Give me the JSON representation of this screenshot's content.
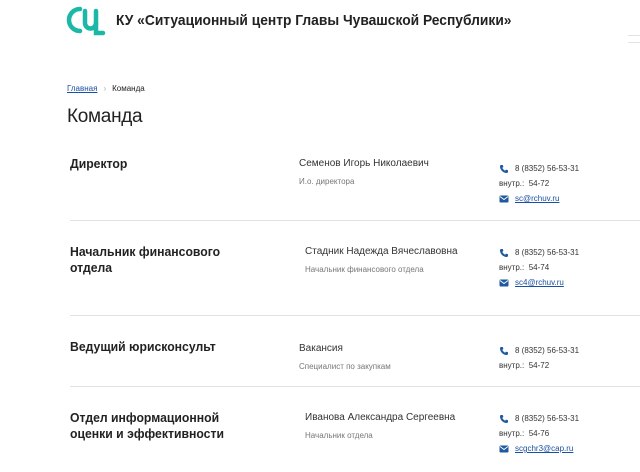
{
  "header": {
    "org_title": "КУ «Ситуационный центр Главы Чувашской Республики»"
  },
  "breadcrumb": {
    "home": "Главная",
    "separator": "›",
    "current": "Команда"
  },
  "page": {
    "title": "Команда"
  },
  "team": [
    {
      "department": "Директор",
      "name": "Семенов Игорь Николаевич",
      "position": "И.о. директора",
      "phone": "8 (8352) 56-53-31",
      "ext_label": "внутр.:",
      "ext": "54-72",
      "email": "sc@rchuv.ru"
    },
    {
      "department": "Начальник финансового отдела",
      "name": "Стадник Надежда Вячеславовна",
      "position": "Начальник финансового отдела",
      "phone": "8 (8352) 56-53-31",
      "ext_label": "внутр.:",
      "ext": "54-74",
      "email": "sc4@rchuv.ru"
    },
    {
      "department": "Ведущий юрисконсульт",
      "name": "Вакансия",
      "position": "Специалист по закупкам",
      "phone": "8 (8352) 56-53-31",
      "ext_label": "внутр.:",
      "ext": "54-72",
      "email": ""
    },
    {
      "department": "Отдел информационной оценки и эффективности",
      "name": "Иванова Александра Сергеевна",
      "position": "Начальник отдела",
      "phone": "8 (8352) 56-53-31",
      "ext_label": "внутр.:",
      "ext": "54-76",
      "email": "scgchr3@cap.ru"
    }
  ],
  "icons": {
    "logo": "situation-center-logo",
    "phone": "phone-icon",
    "email": "envelope-icon"
  },
  "colors": {
    "logo_teal": "#1bb8a8",
    "link": "#1a4fa3",
    "icon_blue": "#1f5a9e"
  }
}
